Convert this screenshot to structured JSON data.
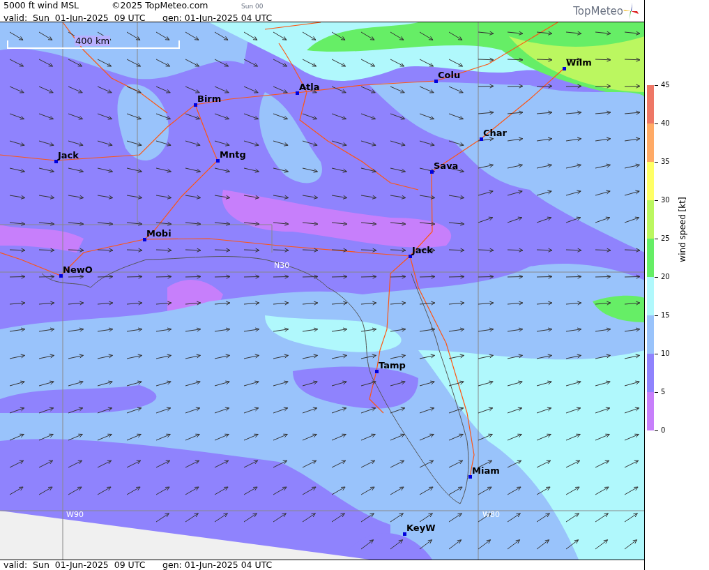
{
  "header": {
    "title": "5000 ft wind MSL",
    "copyright": "©2025 TopMeteo.com",
    "run": "Sun 00",
    "valid": "valid:  Sun  01-Jun-2025  09 UTC",
    "generated": "gen: 01-Jun-2025 04 UTC",
    "logo": "TopMeteo"
  },
  "map": {
    "scale": "400 km",
    "grid_labels": [
      "N30",
      "W90",
      "W80"
    ],
    "cities": [
      {
        "name": "Wilm"
      },
      {
        "name": "Colu"
      },
      {
        "name": "Atla"
      },
      {
        "name": "Birm"
      },
      {
        "name": "Char"
      },
      {
        "name": "Jack"
      },
      {
        "name": "Mntg"
      },
      {
        "name": "Sava"
      },
      {
        "name": "Mobi"
      },
      {
        "name": "Jack"
      },
      {
        "name": "NewO"
      },
      {
        "name": "Tamp"
      },
      {
        "name": "Miam"
      },
      {
        "name": "KeyW"
      }
    ]
  },
  "legend": {
    "title": "wind speed [kt]",
    "bands": [
      {
        "label": "45",
        "color": "#ee7766"
      },
      {
        "label": "40",
        "color": "#ffaa66"
      },
      {
        "label": "35",
        "color": "#ffff66"
      },
      {
        "label": "30",
        "color": "#bbf760"
      },
      {
        "label": "25",
        "color": "#66ee66"
      },
      {
        "label": "20",
        "color": "#b0f8fc"
      },
      {
        "label": "15",
        "color": "#99c3fb"
      },
      {
        "label": "10",
        "color": "#8f83fd"
      },
      {
        "label": "5",
        "color": "#c77ffb"
      }
    ],
    "bottom_label": "0"
  },
  "footer": {
    "valid": "valid:  Sun  01-Jun-2025  09 UTC",
    "generated": "gen: 01-Jun-2025 04 UTC"
  }
}
